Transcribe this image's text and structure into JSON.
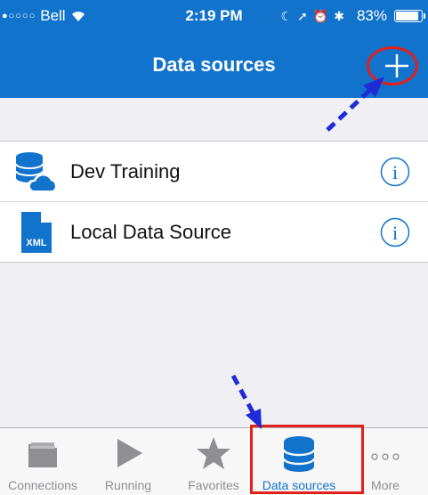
{
  "status_bar": {
    "carrier": "Bell",
    "time": "2:19 PM",
    "battery": "83%",
    "battery_level": 0.83
  },
  "nav": {
    "title": "Data sources",
    "add_icon": "plus-icon"
  },
  "data_sources": [
    {
      "label": "Dev Training",
      "icon": "cloud-database-icon"
    },
    {
      "label": "Local Data Source",
      "icon": "xml-file-icon",
      "icon_text": "XML"
    }
  ],
  "tabs": [
    {
      "label": "Connections",
      "icon": "folder-icon",
      "active": false
    },
    {
      "label": "Running",
      "icon": "play-icon",
      "active": false
    },
    {
      "label": "Favorites",
      "icon": "star-icon",
      "active": false
    },
    {
      "label": "Data sources",
      "icon": "database-icon",
      "active": true
    },
    {
      "label": "More",
      "icon": "more-dots-icon",
      "active": false
    }
  ],
  "colors": {
    "brand_blue": "#1273cc",
    "annotation_red": "#e0211d",
    "annotation_arrow": "#1f2bd6"
  }
}
